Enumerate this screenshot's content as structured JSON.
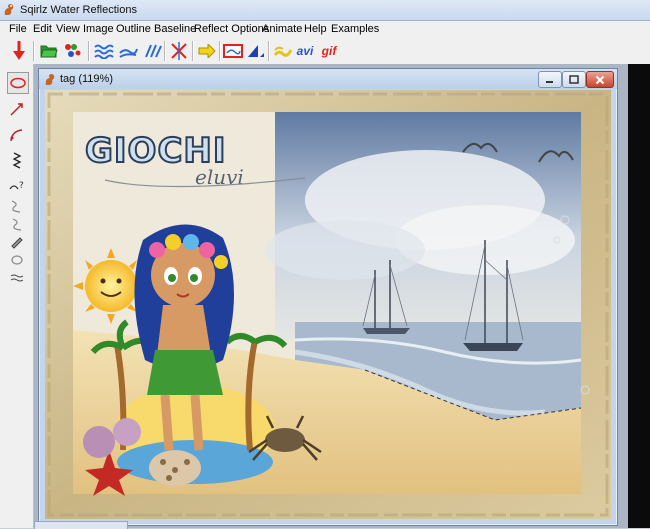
{
  "app": {
    "title": "Sqirlz Water Reflections"
  },
  "menu": [
    "File",
    "Edit",
    "View",
    "Image",
    "Outline",
    "Baseline",
    "Reflect Options",
    "Animate",
    "Help",
    "Examples"
  ],
  "toolbar": {
    "avi_label": "avi",
    "gif_label": "gif"
  },
  "document": {
    "title": "tag  (119%)"
  },
  "artwork": {
    "title_text": "GIOCHI",
    "signature_text": "eluvi"
  },
  "colors": {
    "accent_red": "#e0241c",
    "frame_wood": "#d8c9a0",
    "sea": "#9fb1c8"
  }
}
